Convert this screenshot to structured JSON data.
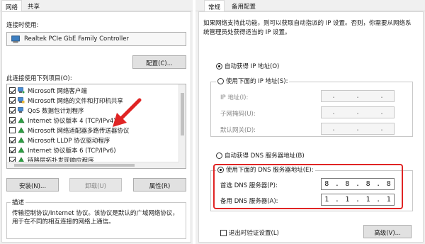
{
  "left": {
    "tabs": [
      "网络",
      "共享"
    ],
    "connect_using_label": "连接时使用:",
    "adapter_name": "Realtek PCIe GbE Family Controller",
    "configure_button": "配置(C)...",
    "items_label": "此连接使用下列项目(O):",
    "items": [
      {
        "label": "Microsoft 网络客户端",
        "checked": true,
        "icon": "network-client-icon"
      },
      {
        "label": "Microsoft 网络的文件和打印机共享",
        "checked": true,
        "icon": "file-share-icon"
      },
      {
        "label": "QoS 数据包计划程序",
        "checked": true,
        "icon": "qos-icon"
      },
      {
        "label": "Internet 协议版本 4 (TCP/IPv4)",
        "checked": true,
        "icon": "protocol-icon"
      },
      {
        "label": "Microsoft 网络适配器多路传送器协议",
        "checked": false,
        "icon": "protocol-icon"
      },
      {
        "label": "Microsoft LLDP 协议驱动程序",
        "checked": true,
        "icon": "protocol-icon"
      },
      {
        "label": "Internet 协议版本 6 (TCP/IPv6)",
        "checked": true,
        "icon": "protocol-icon"
      },
      {
        "label": "链路层拓扑发现响应程序",
        "checked": true,
        "icon": "protocol-icon"
      }
    ],
    "install_button": "安装(N)...",
    "uninstall_button": "卸载(U)",
    "properties_button": "属性(R)",
    "description_title": "描述",
    "description_text": "传输控制协议/Internet 协议。该协议是默认的广域网络协议，用于在不同的相互连接的网络上通信。",
    "arrow_color": "#e02424"
  },
  "right": {
    "tabs": [
      "常规",
      "备用配置"
    ],
    "intro_text": "如果网络支持此功能，则可以获取自动指派的 IP 设置。否则，你需要从网络系统管理员处获得适当的 IP 设置。",
    "auto_ip_label": "自动获得 IP 地址(O)",
    "manual_ip_label": "使用下面的 IP 地址(S):",
    "ip_address_label": "IP 地址(I):",
    "subnet_label": "子网掩码(U):",
    "gateway_label": "默认网关(D):",
    "auto_dns_label": "自动获得 DNS 服务器地址(B)",
    "manual_dns_label": "使用下面的 DNS 服务器地址(E):",
    "preferred_dns_label": "首选 DNS 服务器(P):",
    "preferred_dns": [
      "8",
      "8",
      "8",
      "8"
    ],
    "alternate_dns_label": "备用 DNS 服务器(A):",
    "alternate_dns": [
      "1",
      "1",
      "1",
      "1"
    ],
    "validate_label": "退出时验证设置(L)",
    "advanced_button": "高级(V)...",
    "highlight_color": "#e02424"
  }
}
